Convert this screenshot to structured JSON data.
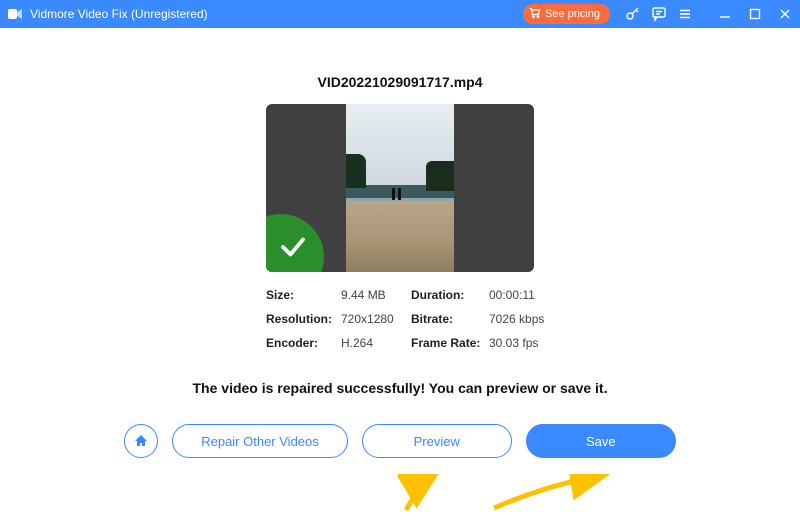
{
  "titlebar": {
    "title": "Vidmore Video Fix (Unregistered)",
    "see_pricing_label": "See pricing"
  },
  "main": {
    "filename": "VID20221029091717.mp4",
    "meta": {
      "size_label": "Size:",
      "size_value": "9.44 MB",
      "duration_label": "Duration:",
      "duration_value": "00:00:11",
      "resolution_label": "Resolution:",
      "resolution_value": "720x1280",
      "bitrate_label": "Bitrate:",
      "bitrate_value": "7026 kbps",
      "encoder_label": "Encoder:",
      "encoder_value": "H.264",
      "framerate_label": "Frame Rate:",
      "framerate_value": "30.03 fps"
    },
    "success_message": "The video is repaired successfully! You can preview or save it."
  },
  "buttons": {
    "repair_other": "Repair Other Videos",
    "preview": "Preview",
    "save": "Save"
  },
  "colors": {
    "accent": "#3b89ff",
    "cta": "#ff6b3d",
    "success": "#2a8e2a",
    "annotation": "#ffc000"
  }
}
